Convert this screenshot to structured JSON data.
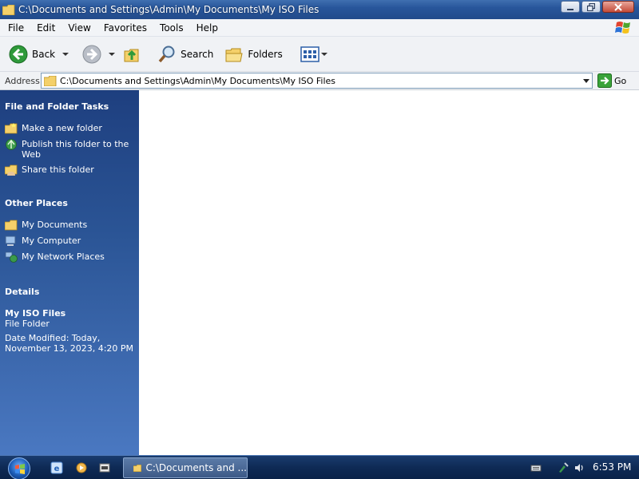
{
  "window": {
    "title": "C:\\Documents and Settings\\Admin\\My Documents\\My ISO Files"
  },
  "menu": [
    "File",
    "Edit",
    "View",
    "Favorites",
    "Tools",
    "Help"
  ],
  "toolbar": {
    "back_label": "Back",
    "search_label": "Search",
    "folders_label": "Folders"
  },
  "address": {
    "label": "Address",
    "value": "C:\\Documents and Settings\\Admin\\My Documents\\My ISO Files",
    "go_label": "Go"
  },
  "taskpane": {
    "file_tasks": {
      "title": "File and Folder Tasks",
      "items": [
        {
          "label": "Make a new folder",
          "icon": "new-folder-icon"
        },
        {
          "label": "Publish this folder to the Web",
          "icon": "publish-web-icon"
        },
        {
          "label": "Share this folder",
          "icon": "share-folder-icon"
        }
      ]
    },
    "other_places": {
      "title": "Other Places",
      "items": [
        {
          "label": "My Documents",
          "icon": "folder-icon"
        },
        {
          "label": "My Computer",
          "icon": "computer-icon"
        },
        {
          "label": "My Network Places",
          "icon": "network-icon"
        }
      ]
    },
    "details": {
      "title": "Details",
      "name": "My ISO Files",
      "type": "File Folder",
      "modified": "Date Modified: Today, November 13, 2023, 4:20 PM"
    }
  },
  "taskbar": {
    "window_label": "C:\\Documents and ...",
    "clock": "6:53 PM"
  },
  "colors": {
    "taskpane_top": "#1e3f7f",
    "taskpane_bottom": "#4a78c1",
    "titlebar": "#28569b",
    "go_green": "#3aa33a",
    "back_green": "#2e9a3a"
  }
}
